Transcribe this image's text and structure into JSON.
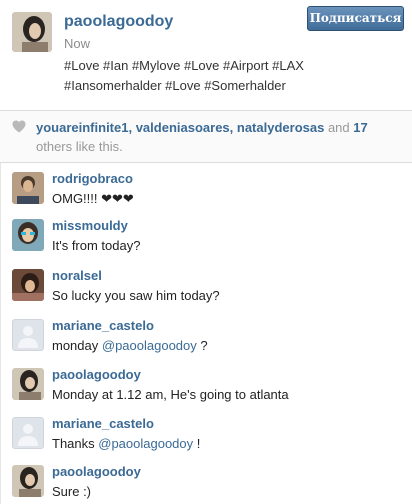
{
  "post": {
    "username": "paoolagoodoy",
    "time": "Now",
    "caption": "#Love #Ian #Mylove #Love #Airport #LAX #Iansomerhalder #Love #Somerhalder",
    "follow_label": "Подписаться"
  },
  "likes": {
    "users": [
      "youareinfinite1",
      "valdeniasoares",
      "natalyderosas"
    ],
    "sep1": ", ",
    "sep2": ", ",
    "and_text": " and ",
    "count": "17",
    "suffix": " others like this."
  },
  "comments": [
    {
      "user": "rodrigobraco",
      "text": "OMG!!!! ❤❤❤"
    },
    {
      "user": "missmouldy",
      "text": "It's from today?"
    },
    {
      "user": "noralsel",
      "text": "So lucky  you saw him today?"
    },
    {
      "user": "mariane_castelo",
      "text_before": "monday ",
      "mention": "@paoolagoodoy",
      "text_after": " ?"
    },
    {
      "user": "paoolagoodoy",
      "text": "Monday at 1.12 am, He's going to atlanta"
    },
    {
      "user": "mariane_castelo",
      "text_before": "Thanks ",
      "mention": "@paoolagoodoy",
      "text_after": " !"
    },
    {
      "user": "paoolagoodoy",
      "text": "Sure :)"
    }
  ],
  "icons": {
    "likes": "heart-icon",
    "placeholder_avatar": "person-silhouette-icon"
  },
  "colors": {
    "link": "#3b6a95",
    "button": "#4f7aa6"
  }
}
